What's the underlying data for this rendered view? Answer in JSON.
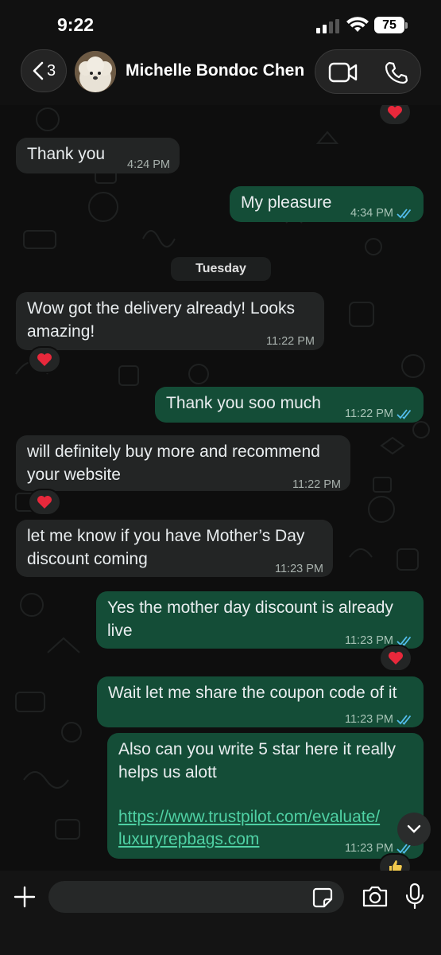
{
  "status_bar": {
    "time": "9:22",
    "battery": "75"
  },
  "header": {
    "back_count": "3",
    "contact_name": "Michelle Bondoc Chen"
  },
  "date_divider": "Tuesday",
  "messages": [
    {
      "direction": "in",
      "text": "Thank you",
      "time": "4:24 PM"
    },
    {
      "direction": "out",
      "text": "My pleasure",
      "time": "4:34 PM",
      "read": true
    },
    {
      "direction": "in",
      "text": "Wow got the delivery already! Looks\namazing!",
      "time": "11:22 PM",
      "reaction": "heart"
    },
    {
      "direction": "out",
      "text": "Thank you soo much",
      "time": "11:22 PM",
      "read": true
    },
    {
      "direction": "in",
      "text": "will definitely buy more and recommend\nyour website",
      "time": "11:22 PM",
      "reaction": "heart"
    },
    {
      "direction": "in",
      "text": "let me know if you have Mother’s Day\ndiscount coming",
      "time": "11:23 PM"
    },
    {
      "direction": "out",
      "text": "Yes the mother day discount is already\nlive",
      "time": "11:23 PM",
      "read": true,
      "reaction": "heart"
    },
    {
      "direction": "out",
      "text": "Wait let me share the coupon code of it",
      "time": "11:23 PM",
      "read": true
    },
    {
      "direction": "out",
      "text": "Also can you write 5 star here it really\nhelps us alott",
      "link_line1": "https://www.trustpilot.com/evaluate/",
      "link_line2": "luxuryrepbags.com",
      "time": "11:23 PM",
      "read": true,
      "reaction": "thumbs-up"
    }
  ],
  "input": {
    "placeholder": ""
  },
  "colors": {
    "incoming_bubble": "#232525",
    "outgoing_bubble": "#144d37",
    "read_ticks": "#53bdeb",
    "link": "#4fd1a4"
  }
}
